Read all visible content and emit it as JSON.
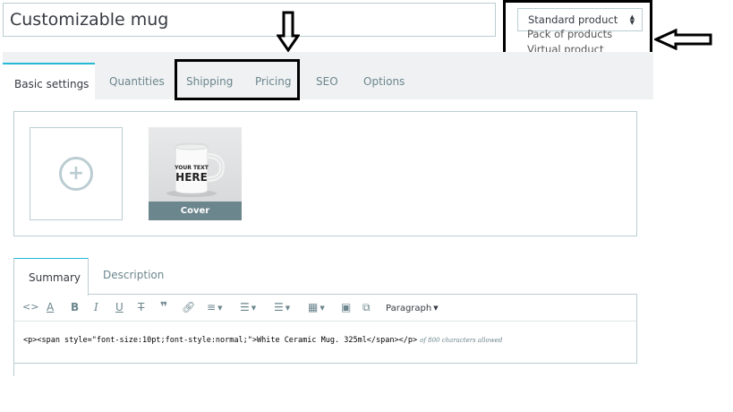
{
  "product": {
    "name": "Customizable mug"
  },
  "product_type": {
    "selected": "Standard product",
    "options": [
      "Pack of products",
      "Virtual product"
    ],
    "help_label": "?"
  },
  "tabs": [
    {
      "label": "Basic settings",
      "active": true
    },
    {
      "label": "Quantities"
    },
    {
      "label": "Shipping"
    },
    {
      "label": "Pricing"
    },
    {
      "label": "SEO"
    },
    {
      "label": "Options"
    }
  ],
  "images": {
    "cover_label": "Cover",
    "mug_text_line1": "YOUR TEXT",
    "mug_text_line2": "HERE"
  },
  "description_tabs": [
    {
      "label": "Summary",
      "active": true
    },
    {
      "label": "Description"
    }
  ],
  "editor": {
    "format_label": "Paragraph",
    "content": "<p><span style=\"font-size:10pt;font-style:normal;\">White Ceramic Mug. 325ml</span></p>",
    "char_limit_note": "of 800 characters allowed"
  },
  "colors": {
    "accent": "#25b9d7",
    "border": "#bbcdd2",
    "muted": "#6c868e",
    "tab_bar_bg": "#eff1f2"
  }
}
